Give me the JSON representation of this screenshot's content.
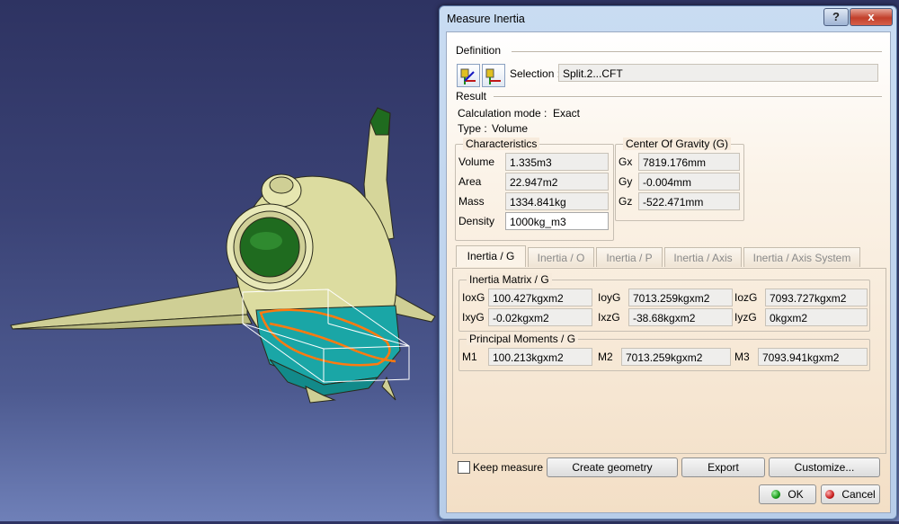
{
  "dialog": {
    "title": "Measure Inertia",
    "help_label": "?",
    "close_label": "x"
  },
  "definition": {
    "section_label": "Definition",
    "selection_label": "Selection :",
    "selection_value": "Split.2...CFT"
  },
  "result": {
    "section_label": "Result",
    "calc_mode_label": "Calculation mode :",
    "calc_mode_value": "Exact",
    "type_label": "Type :",
    "type_value": "Volume"
  },
  "characteristics": {
    "title": "Characteristics",
    "rows": [
      {
        "label": "Volume",
        "value": "1.335m3"
      },
      {
        "label": "Area",
        "value": "22.947m2"
      },
      {
        "label": "Mass",
        "value": "1334.841kg"
      },
      {
        "label": "Density",
        "value": "1000kg_m3"
      }
    ]
  },
  "center_of_gravity": {
    "title": "Center Of Gravity (G)",
    "rows": [
      {
        "label": "Gx",
        "value": "7819.176mm"
      },
      {
        "label": "Gy",
        "value": "-0.004mm"
      },
      {
        "label": "Gz",
        "value": "-522.471mm"
      }
    ]
  },
  "tabs": [
    {
      "label": "Inertia / G",
      "active": true
    },
    {
      "label": "Inertia / O",
      "active": false
    },
    {
      "label": "Inertia / P",
      "active": false
    },
    {
      "label": "Inertia / Axis",
      "active": false
    },
    {
      "label": "Inertia / Axis System",
      "active": false
    }
  ],
  "inertia_matrix": {
    "title": "Inertia Matrix / G",
    "row1": [
      {
        "label": "IoxG",
        "value": "100.427kgxm2"
      },
      {
        "label": "IoyG",
        "value": "7013.259kgxm2"
      },
      {
        "label": "IozG",
        "value": "7093.727kgxm2"
      }
    ],
    "row2": [
      {
        "label": "IxyG",
        "value": "-0.02kgxm2"
      },
      {
        "label": "IxzG",
        "value": "-38.68kgxm2"
      },
      {
        "label": "IyzG",
        "value": "0kgxm2"
      }
    ]
  },
  "principal_moments": {
    "title": "Principal Moments / G",
    "row": [
      {
        "label": "M1",
        "value": "100.213kgxm2"
      },
      {
        "label": "M2",
        "value": "7013.259kgxm2"
      },
      {
        "label": "M3",
        "value": "7093.941kgxm2"
      }
    ]
  },
  "footer": {
    "keep_measure_label": "Keep measure",
    "keep_measure_checked": false,
    "create_geometry_label": "Create geometry",
    "export_label": "Export",
    "customize_label": "Customize...",
    "ok_label": "OK",
    "cancel_label": "Cancel"
  },
  "colors": {
    "aircraft_body": "#dcdca0",
    "aircraft_green": "#1f6b1f",
    "selection_cyan": "#1aa6a6",
    "selection_orange": "#ff7a10",
    "ok_green": "#1a9a1a",
    "cancel_red": "#c81e1e"
  }
}
